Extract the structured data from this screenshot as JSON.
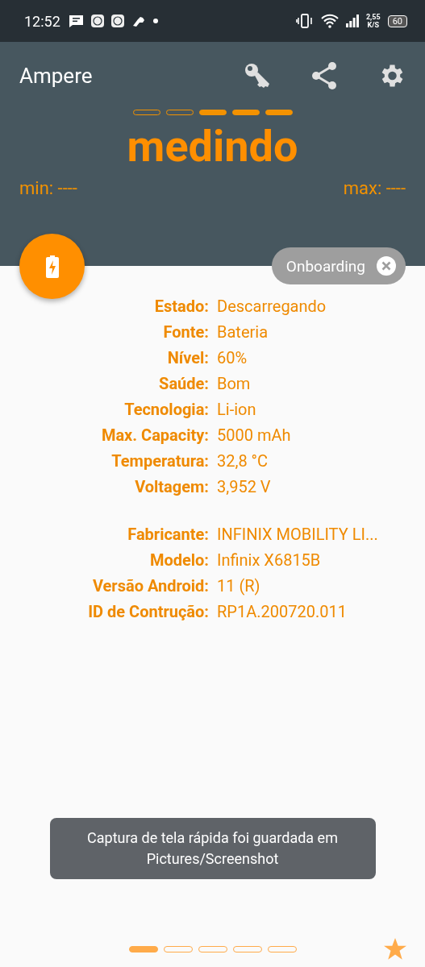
{
  "status_bar": {
    "time": "12:52",
    "net_speed": "2,55",
    "net_unit": "K/S",
    "battery": "60"
  },
  "app_bar": {
    "title": "Ampere"
  },
  "meter": {
    "segments": [
      {
        "filled": false
      },
      {
        "filled": false
      },
      {
        "filled": true
      },
      {
        "filled": true
      },
      {
        "filled": true
      }
    ],
    "reading": "medindo",
    "min": "min: ----",
    "max": "max: ----"
  },
  "chip": {
    "label": "Onboarding"
  },
  "groups": [
    {
      "rows": [
        {
          "label": "Estado:",
          "value": "Descarregando"
        },
        {
          "label": "Fonte:",
          "value": "Bateria"
        },
        {
          "label": "Nível:",
          "value": "60%"
        },
        {
          "label": "Saúde:",
          "value": "Bom"
        },
        {
          "label": "Tecnologia:",
          "value": "Li-ion"
        },
        {
          "label": "Max. Capacity:",
          "value": "5000 mAh"
        },
        {
          "label": "Temperatura:",
          "value": "32,8 °C"
        },
        {
          "label": "Voltagem:",
          "value": "3,952 V"
        }
      ]
    },
    {
      "rows": [
        {
          "label": "Fabricante:",
          "value": "INFINIX MOBILITY LI..."
        },
        {
          "label": "Modelo:",
          "value": "Infinix X6815B"
        },
        {
          "label": "Versão Android:",
          "value": "11 (R)"
        },
        {
          "label": "ID de Contrução:",
          "value": "RP1A.200720.011"
        }
      ]
    }
  ],
  "toast": {
    "text": "Captura de tela rápida foi guardada em Pictures/Screenshot"
  },
  "pager": [
    {
      "selected": true
    },
    {
      "selected": false
    },
    {
      "selected": false
    },
    {
      "selected": false
    },
    {
      "selected": false
    }
  ]
}
